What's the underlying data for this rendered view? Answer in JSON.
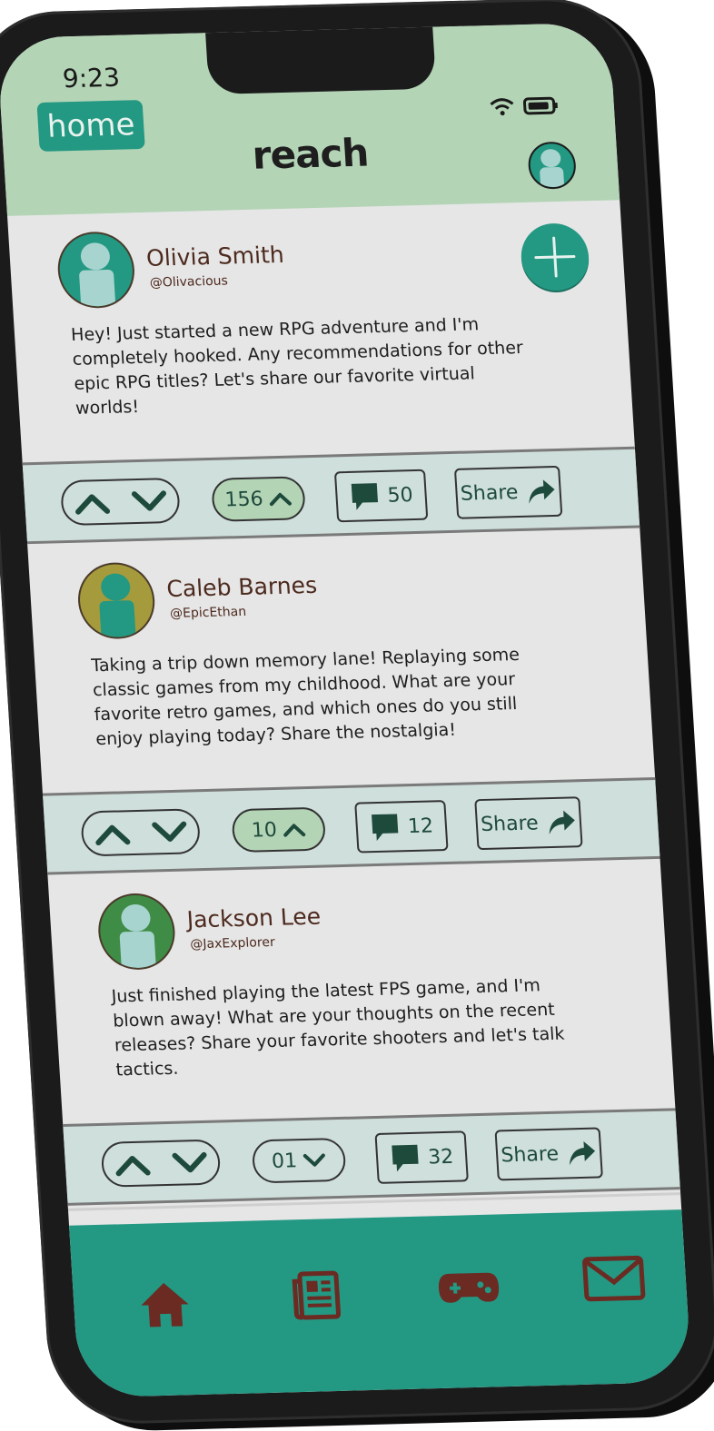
{
  "status_bar": {
    "time": "9:23"
  },
  "header": {
    "home_label": "home",
    "brand": "reach"
  },
  "posts": [
    {
      "name": "Olivia Smith",
      "handle": "@Olivacious",
      "text": "Hey! Just started a new RPG adventure and I'm completely hooked. Any recommendations for other epic RPG titles? Let's share our favorite virtual worlds!",
      "score": "156",
      "score_direction": "up",
      "comments": "50",
      "share_label": "Share",
      "avatar_color": "#239882",
      "avatar_figure": "#a7d4cf"
    },
    {
      "name": "Caleb Barnes",
      "handle": "@EpicEthan",
      "text": "Taking a trip down memory lane! Replaying some classic games from my childhood. What are your favorite retro games, and which ones do you still enjoy playing today? Share the nostalgia!",
      "score": "10",
      "score_direction": "up",
      "comments": "12",
      "share_label": "Share",
      "avatar_color": "#a59b3c",
      "avatar_figure": "#239882"
    },
    {
      "name": "Jackson Lee",
      "handle": "@JaxExplorer",
      "text": "Just finished playing the latest FPS game, and I'm blown away! What are your thoughts on the recent releases? Share your favorite shooters and let's talk tactics.",
      "score": "01",
      "score_direction": "down",
      "comments": "32",
      "share_label": "Share",
      "avatar_color": "#3f8c46",
      "avatar_figure": "#a7d4cf"
    }
  ],
  "colors": {
    "accent": "#239882",
    "header_bg": "#b4d4b6",
    "action_bar_bg": "#cfdfdc",
    "nav_icon": "#6b2a22",
    "name_text": "#4d2a1e"
  },
  "bottom_nav": [
    "home-icon",
    "news-icon",
    "gamepad-icon",
    "mail-icon"
  ]
}
